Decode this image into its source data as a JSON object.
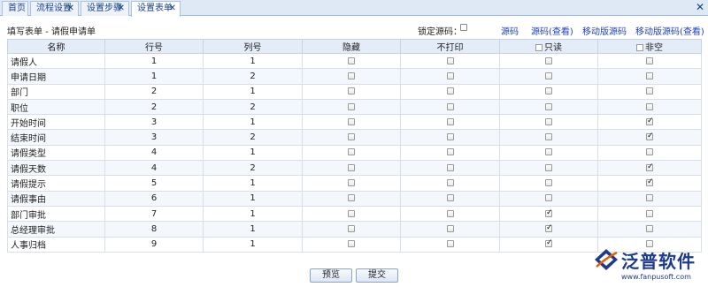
{
  "tabs": [
    {
      "label": "首页",
      "closable": false
    },
    {
      "label": "流程设置",
      "closable": true
    },
    {
      "label": "设置步骤",
      "closable": true
    },
    {
      "label": "设置表单",
      "closable": true
    }
  ],
  "header": {
    "title": "填写表单 - 请假申请单",
    "lock_label": "锁定源码：",
    "links": [
      "源码",
      "源码(查看)",
      "移动版源码",
      "移动版源码(查看)"
    ]
  },
  "columns": [
    "名称",
    "行号",
    "列号",
    "隐藏",
    "不打印",
    "只读",
    "非空"
  ],
  "rows": [
    {
      "name": "请假人",
      "row": "1",
      "col": "1",
      "hide": false,
      "noprint": false,
      "readonly": false,
      "required": false
    },
    {
      "name": "申请日期",
      "row": "1",
      "col": "2",
      "hide": false,
      "noprint": false,
      "readonly": false,
      "required": false
    },
    {
      "name": "部门",
      "row": "2",
      "col": "1",
      "hide": false,
      "noprint": false,
      "readonly": false,
      "required": false
    },
    {
      "name": "职位",
      "row": "2",
      "col": "2",
      "hide": false,
      "noprint": false,
      "readonly": false,
      "required": false
    },
    {
      "name": "开始时间",
      "row": "3",
      "col": "1",
      "hide": false,
      "noprint": false,
      "readonly": false,
      "required": true
    },
    {
      "name": "结束时间",
      "row": "3",
      "col": "2",
      "hide": false,
      "noprint": false,
      "readonly": false,
      "required": true
    },
    {
      "name": "请假类型",
      "row": "4",
      "col": "1",
      "hide": false,
      "noprint": false,
      "readonly": false,
      "required": false
    },
    {
      "name": "请假天数",
      "row": "4",
      "col": "2",
      "hide": false,
      "noprint": false,
      "readonly": false,
      "required": true
    },
    {
      "name": "请假提示",
      "row": "5",
      "col": "1",
      "hide": false,
      "noprint": false,
      "readonly": false,
      "required": true
    },
    {
      "name": "请假事由",
      "row": "6",
      "col": "1",
      "hide": false,
      "noprint": false,
      "readonly": false,
      "required": false
    },
    {
      "name": "部门审批",
      "row": "7",
      "col": "1",
      "hide": false,
      "noprint": false,
      "readonly": true,
      "required": false
    },
    {
      "name": "总经理审批",
      "row": "8",
      "col": "1",
      "hide": false,
      "noprint": false,
      "readonly": true,
      "required": false
    },
    {
      "name": "人事归档",
      "row": "9",
      "col": "1",
      "hide": false,
      "noprint": false,
      "readonly": true,
      "required": false
    }
  ],
  "buttons": {
    "preview": "预览",
    "submit": "提交"
  },
  "logo": {
    "text": "泛普软件",
    "url": "www.fanpusoft.com"
  },
  "colors": {
    "tab_bar": "#dfe9f6",
    "header_row": "#e4ecf7",
    "link": "#1c3fc7",
    "logo": "#1e3a8a"
  }
}
